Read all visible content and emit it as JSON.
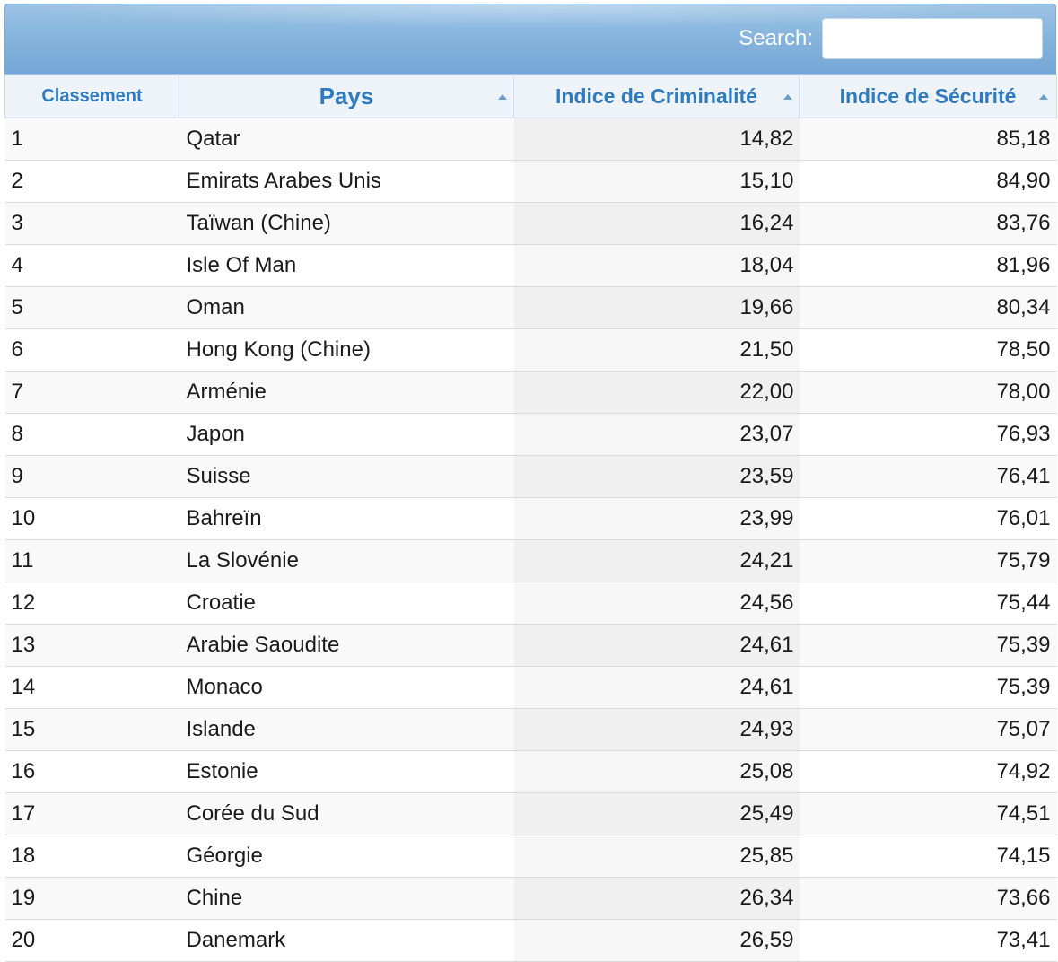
{
  "search": {
    "label": "Search:",
    "value": ""
  },
  "table": {
    "headers": {
      "rank": "Classement",
      "country": "Pays",
      "crime": "Indice de Criminalité",
      "safety": "Indice de Sécurité"
    },
    "rows": [
      {
        "rank": "1",
        "country": "Qatar",
        "crime": "14,82",
        "safety": "85,18"
      },
      {
        "rank": "2",
        "country": "Emirats Arabes Unis",
        "crime": "15,10",
        "safety": "84,90"
      },
      {
        "rank": "3",
        "country": "Taïwan (Chine)",
        "crime": "16,24",
        "safety": "83,76"
      },
      {
        "rank": "4",
        "country": "Isle Of Man",
        "crime": "18,04",
        "safety": "81,96"
      },
      {
        "rank": "5",
        "country": "Oman",
        "crime": "19,66",
        "safety": "80,34"
      },
      {
        "rank": "6",
        "country": "Hong Kong (Chine)",
        "crime": "21,50",
        "safety": "78,50"
      },
      {
        "rank": "7",
        "country": "Arménie",
        "crime": "22,00",
        "safety": "78,00"
      },
      {
        "rank": "8",
        "country": "Japon",
        "crime": "23,07",
        "safety": "76,93"
      },
      {
        "rank": "9",
        "country": "Suisse",
        "crime": "23,59",
        "safety": "76,41"
      },
      {
        "rank": "10",
        "country": "Bahreïn",
        "crime": "23,99",
        "safety": "76,01"
      },
      {
        "rank": "11",
        "country": "La Slovénie",
        "crime": "24,21",
        "safety": "75,79"
      },
      {
        "rank": "12",
        "country": "Croatie",
        "crime": "24,56",
        "safety": "75,44"
      },
      {
        "rank": "13",
        "country": "Arabie Saoudite",
        "crime": "24,61",
        "safety": "75,39"
      },
      {
        "rank": "14",
        "country": "Monaco",
        "crime": "24,61",
        "safety": "75,39"
      },
      {
        "rank": "15",
        "country": "Islande",
        "crime": "24,93",
        "safety": "75,07"
      },
      {
        "rank": "16",
        "country": "Estonie",
        "crime": "25,08",
        "safety": "74,92"
      },
      {
        "rank": "17",
        "country": "Corée du Sud",
        "crime": "25,49",
        "safety": "74,51"
      },
      {
        "rank": "18",
        "country": "Géorgie",
        "crime": "25,85",
        "safety": "74,15"
      },
      {
        "rank": "19",
        "country": "Chine",
        "crime": "26,34",
        "safety": "73,66"
      },
      {
        "rank": "20",
        "country": "Danemark",
        "crime": "26,59",
        "safety": "73,41"
      }
    ]
  },
  "colors": {
    "header_text": "#2f7bbf",
    "toolbar": "#86b5dd"
  },
  "icons": {
    "sort": "sort-asc-icon"
  }
}
